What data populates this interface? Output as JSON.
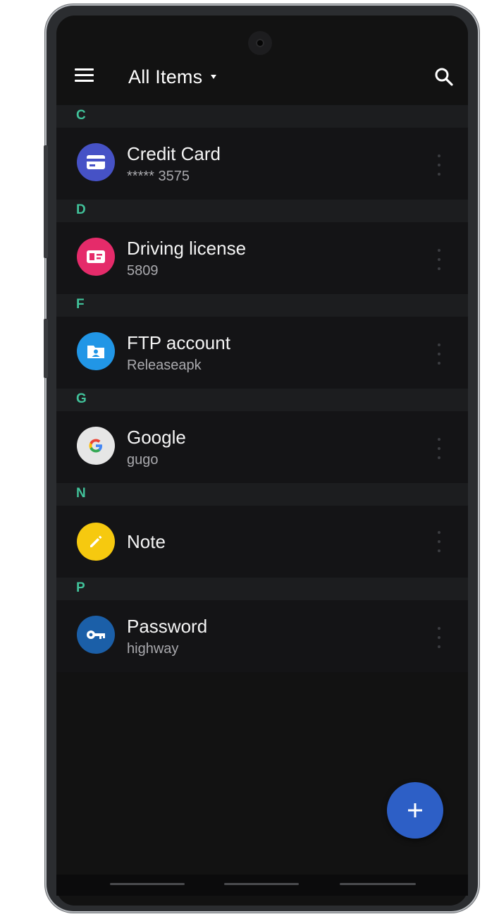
{
  "toolbar": {
    "title": "All Items",
    "menu_icon": "hamburger-menu-icon",
    "search_icon": "search-icon"
  },
  "accent_color": "#41c29a",
  "fab_color": "#2d5fc6",
  "groups": [
    {
      "letter": "C",
      "item": {
        "title": "Credit Card",
        "subtitle": "***** 3575",
        "icon": "credit-card-icon",
        "color": "#4652c6"
      }
    },
    {
      "letter": "D",
      "item": {
        "title": "Driving license",
        "subtitle": "5809",
        "icon": "id-card-icon",
        "color": "#e52b6a"
      }
    },
    {
      "letter": "F",
      "item": {
        "title": "FTP account",
        "subtitle": "Releaseapk",
        "icon": "folder-account-icon",
        "color": "#2196e6"
      }
    },
    {
      "letter": "G",
      "item": {
        "title": "Google",
        "subtitle": "gugo",
        "icon": "google-logo-icon",
        "color": "#e6e6e6"
      }
    },
    {
      "letter": "N",
      "item": {
        "title": "Note",
        "subtitle": "",
        "icon": "pencil-icon",
        "color": "#f6c90f"
      }
    },
    {
      "letter": "P",
      "item": {
        "title": "Password",
        "subtitle": "highway",
        "icon": "key-icon",
        "color": "#1b5fa8"
      }
    }
  ],
  "fab": {
    "icon": "plus-icon"
  }
}
